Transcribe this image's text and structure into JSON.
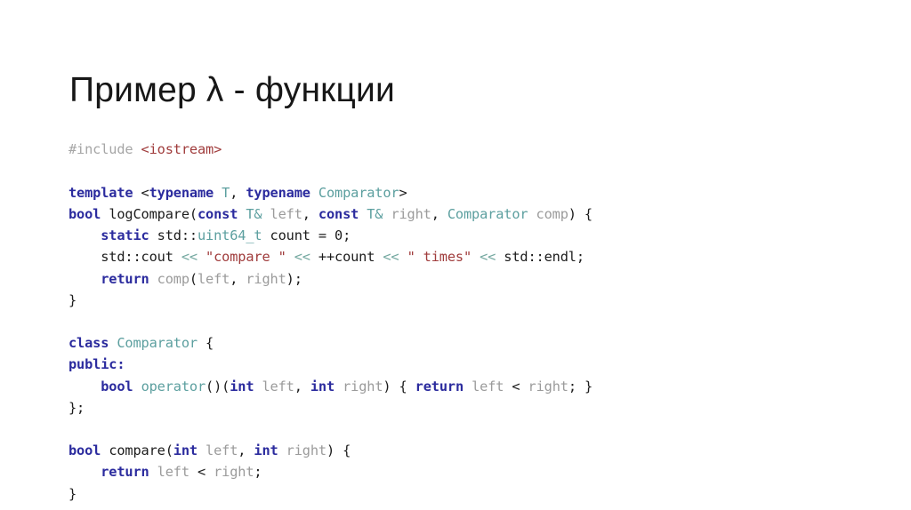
{
  "slide": {
    "title": "Пример λ - функции",
    "background_color": "#ffffff"
  },
  "colors": {
    "title": "#171717",
    "keyword": "#2b2b9e",
    "type": "#5c9f9f",
    "string": "#a03c3c",
    "preprocessor": "#a6a6a6",
    "identifier": "#9b9b9b",
    "operator": "#74a8a0",
    "plain": "#1c1c1c"
  },
  "code": {
    "language": "C++",
    "lines": [
      {
        "id": "line-include",
        "text": "#include <iostream>",
        "tokens": [
          {
            "text": "#include ",
            "kind": "preprocessor"
          },
          {
            "text": "<iostream>",
            "kind": "string"
          }
        ]
      },
      {
        "id": "line-blank-1",
        "text": "",
        "tokens": []
      },
      {
        "id": "line-template",
        "text": "template <typename T, typename Comparator>",
        "tokens": [
          {
            "text": "template ",
            "kind": "keyword"
          },
          {
            "text": "<",
            "kind": "plain"
          },
          {
            "text": "typename ",
            "kind": "keyword"
          },
          {
            "text": "T",
            "kind": "type"
          },
          {
            "text": ", ",
            "kind": "plain"
          },
          {
            "text": "typename ",
            "kind": "keyword"
          },
          {
            "text": "Comparator",
            "kind": "type"
          },
          {
            "text": ">",
            "kind": "plain"
          }
        ]
      },
      {
        "id": "line-logcompare-sig",
        "text": "bool logCompare(const T& left, const T& right, Comparator comp) {",
        "tokens": [
          {
            "text": "bool ",
            "kind": "keyword"
          },
          {
            "text": "logCompare(",
            "kind": "plain"
          },
          {
            "text": "const ",
            "kind": "keyword"
          },
          {
            "text": "T&",
            "kind": "type"
          },
          {
            "text": " ",
            "kind": "plain"
          },
          {
            "text": "left",
            "kind": "identifier"
          },
          {
            "text": ", ",
            "kind": "plain"
          },
          {
            "text": "const ",
            "kind": "keyword"
          },
          {
            "text": "T&",
            "kind": "type"
          },
          {
            "text": " ",
            "kind": "plain"
          },
          {
            "text": "right",
            "kind": "identifier"
          },
          {
            "text": ", ",
            "kind": "plain"
          },
          {
            "text": "Comparator",
            "kind": "type"
          },
          {
            "text": " ",
            "kind": "plain"
          },
          {
            "text": "comp",
            "kind": "identifier"
          },
          {
            "text": ") {",
            "kind": "plain"
          }
        ]
      },
      {
        "id": "line-static-count",
        "text": "    static std::uint64_t count = 0;",
        "tokens": [
          {
            "text": "    ",
            "kind": "plain"
          },
          {
            "text": "static ",
            "kind": "keyword"
          },
          {
            "text": "std::",
            "kind": "plain"
          },
          {
            "text": "uint64_t",
            "kind": "type"
          },
          {
            "text": " count = ",
            "kind": "plain"
          },
          {
            "text": "0",
            "kind": "plain"
          },
          {
            "text": ";",
            "kind": "plain"
          }
        ]
      },
      {
        "id": "line-cout",
        "text": "    std::cout << \"compare \" << ++count << \" times\" << std::endl;",
        "tokens": [
          {
            "text": "    std::cout ",
            "kind": "plain"
          },
          {
            "text": "<<",
            "kind": "operator"
          },
          {
            "text": " ",
            "kind": "plain"
          },
          {
            "text": "\"compare \"",
            "kind": "string"
          },
          {
            "text": " ",
            "kind": "plain"
          },
          {
            "text": "<<",
            "kind": "operator"
          },
          {
            "text": " ++count ",
            "kind": "plain"
          },
          {
            "text": "<<",
            "kind": "operator"
          },
          {
            "text": " ",
            "kind": "plain"
          },
          {
            "text": "\" times\"",
            "kind": "string"
          },
          {
            "text": " ",
            "kind": "plain"
          },
          {
            "text": "<<",
            "kind": "operator"
          },
          {
            "text": " std::endl;",
            "kind": "plain"
          }
        ]
      },
      {
        "id": "line-return-comp",
        "text": "    return comp(left, right);",
        "tokens": [
          {
            "text": "    ",
            "kind": "plain"
          },
          {
            "text": "return ",
            "kind": "keyword"
          },
          {
            "text": "comp",
            "kind": "identifier"
          },
          {
            "text": "(",
            "kind": "plain"
          },
          {
            "text": "left",
            "kind": "identifier"
          },
          {
            "text": ", ",
            "kind": "plain"
          },
          {
            "text": "right",
            "kind": "identifier"
          },
          {
            "text": ");",
            "kind": "plain"
          }
        ]
      },
      {
        "id": "line-close-fn",
        "text": "}",
        "tokens": [
          {
            "text": "}",
            "kind": "plain"
          }
        ]
      },
      {
        "id": "line-blank-2",
        "text": "",
        "tokens": []
      },
      {
        "id": "line-class",
        "text": "class Comparator {",
        "tokens": [
          {
            "text": "class ",
            "kind": "keyword"
          },
          {
            "text": "Comparator",
            "kind": "type"
          },
          {
            "text": " {",
            "kind": "plain"
          }
        ]
      },
      {
        "id": "line-public",
        "text": "public:",
        "tokens": [
          {
            "text": "public:",
            "kind": "keyword"
          }
        ]
      },
      {
        "id": "line-operator",
        "text": "    bool operator()(int left, int right) { return left < right; }",
        "tokens": [
          {
            "text": "    ",
            "kind": "plain"
          },
          {
            "text": "bool ",
            "kind": "keyword"
          },
          {
            "text": "operator",
            "kind": "type"
          },
          {
            "text": "()(",
            "kind": "plain"
          },
          {
            "text": "int",
            "kind": "keyword"
          },
          {
            "text": " ",
            "kind": "plain"
          },
          {
            "text": "left",
            "kind": "identifier"
          },
          {
            "text": ", ",
            "kind": "plain"
          },
          {
            "text": "int",
            "kind": "keyword"
          },
          {
            "text": " ",
            "kind": "plain"
          },
          {
            "text": "right",
            "kind": "identifier"
          },
          {
            "text": ") { ",
            "kind": "plain"
          },
          {
            "text": "return ",
            "kind": "keyword"
          },
          {
            "text": "left",
            "kind": "identifier"
          },
          {
            "text": " < ",
            "kind": "plain"
          },
          {
            "text": "right",
            "kind": "identifier"
          },
          {
            "text": "; }",
            "kind": "plain"
          }
        ]
      },
      {
        "id": "line-close-class",
        "text": "};",
        "tokens": [
          {
            "text": "};",
            "kind": "plain"
          }
        ]
      },
      {
        "id": "line-blank-3",
        "text": "",
        "tokens": []
      },
      {
        "id": "line-compare-sig",
        "text": "bool compare(int left, int right) {",
        "tokens": [
          {
            "text": "bool ",
            "kind": "keyword"
          },
          {
            "text": "compare(",
            "kind": "plain"
          },
          {
            "text": "int",
            "kind": "keyword"
          },
          {
            "text": " ",
            "kind": "plain"
          },
          {
            "text": "left",
            "kind": "identifier"
          },
          {
            "text": ", ",
            "kind": "plain"
          },
          {
            "text": "int",
            "kind": "keyword"
          },
          {
            "text": " ",
            "kind": "plain"
          },
          {
            "text": "right",
            "kind": "identifier"
          },
          {
            "text": ") {",
            "kind": "plain"
          }
        ]
      },
      {
        "id": "line-return-less",
        "text": "    return left < right;",
        "tokens": [
          {
            "text": "    ",
            "kind": "plain"
          },
          {
            "text": "return ",
            "kind": "keyword"
          },
          {
            "text": "left",
            "kind": "identifier"
          },
          {
            "text": " < ",
            "kind": "plain"
          },
          {
            "text": "right",
            "kind": "identifier"
          },
          {
            "text": ";",
            "kind": "plain"
          }
        ]
      },
      {
        "id": "line-close-compare",
        "text": "}",
        "tokens": [
          {
            "text": "}",
            "kind": "plain"
          }
        ]
      }
    ]
  }
}
